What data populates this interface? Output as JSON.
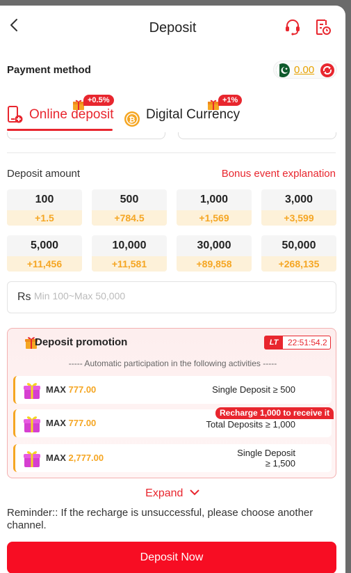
{
  "header": {
    "title": "Deposit"
  },
  "payment_method": {
    "label": "Payment method",
    "balance": "0.00"
  },
  "tabs": [
    {
      "label": "Online deposit",
      "badge": "+0.5%",
      "active": true
    },
    {
      "label": "Digital Currency",
      "badge": "+1%",
      "active": false
    }
  ],
  "deposit": {
    "label": "Deposit amount",
    "bonus_link": "Bonus event explanation",
    "amounts": [
      {
        "value": "100",
        "bonus": "+1.5"
      },
      {
        "value": "500",
        "bonus": "+784.5"
      },
      {
        "value": "1,000",
        "bonus": "+1,569"
      },
      {
        "value": "3,000",
        "bonus": "+3,599"
      },
      {
        "value": "5,000",
        "bonus": "+11,456"
      },
      {
        "value": "10,000",
        "bonus": "+11,581"
      },
      {
        "value": "30,000",
        "bonus": "+89,858"
      },
      {
        "value": "50,000",
        "bonus": "+268,135"
      }
    ],
    "currency": "Rs",
    "placeholder": "Min 100~Max 50,000"
  },
  "promotion": {
    "title": "Deposit promotion",
    "lt_tag": "LT",
    "timer": "22:51:54.2",
    "note": "----- Automatic participation in the following activities -----",
    "activities": [
      {
        "max_label": "MAX",
        "max_value": "777.00",
        "condition_line1": "Single Deposit ≥ 500",
        "condition_line2": ""
      },
      {
        "max_label": "MAX",
        "max_value": "777.00",
        "condition_line1": "Total Deposits ≥ 1,000",
        "condition_line2": "",
        "tag": "Recharge 1,000 to receive it"
      },
      {
        "max_label": "MAX",
        "max_value": "2,777.00",
        "condition_line1": "Single Deposit",
        "condition_line2": "≥ 1,500"
      }
    ]
  },
  "expand_label": "Expand",
  "reminder": "Reminder:: If the recharge is unsuccessful, please choose another channel.",
  "deposit_button": "Deposit Now",
  "colors": {
    "accent": "#e8262e",
    "bonus": "#f5a623",
    "button": "#f70d23"
  }
}
